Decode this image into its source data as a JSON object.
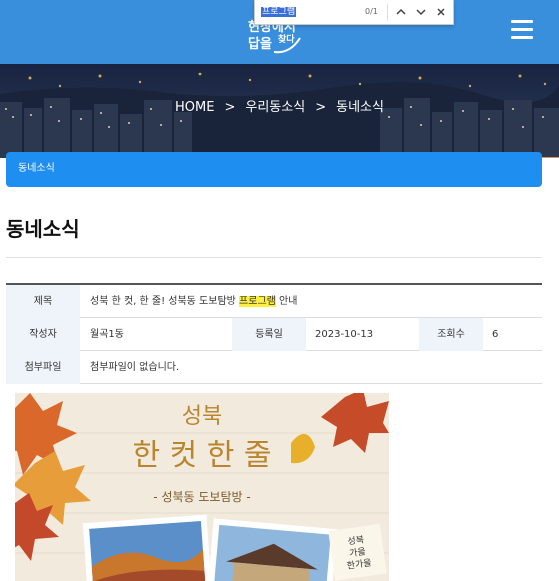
{
  "find_bar": {
    "query": "프로그램",
    "count": "0/1",
    "prev_icon": "chevron-up-icon",
    "next_icon": "chevron-down-icon",
    "close_icon": "close-icon"
  },
  "header": {
    "logo_text": "현장에서 답을 찾다",
    "menu_icon": "hamburger-menu-icon",
    "color": "#3a8fdd"
  },
  "breadcrumb": {
    "items": [
      "HOME",
      "우리동소식",
      "동네소식"
    ],
    "separator": ">"
  },
  "section_bar": {
    "label": "동네소식",
    "color": "#1e8ef0"
  },
  "page_title": "동네소식",
  "post": {
    "title_label": "제목",
    "title_before": "성북 한 컷, 한 줄! 성북동 도보탐방 ",
    "title_highlight": "프로그램",
    "title_after": " 안내",
    "author_label": "작성자",
    "author": "월곡1동",
    "date_label": "등록일",
    "date": "2023-10-13",
    "views_label": "조회수",
    "views": "6",
    "attachment_label": "첨부파일",
    "attachment": "첨부파일이 없습니다."
  },
  "poster": {
    "title_line1": "성북",
    "title_line2": "한 컷 한 줄",
    "subtitle": "- 성북동 도보탐방 -",
    "caption_lines": [
      "성북",
      "가을",
      "한가을"
    ]
  }
}
